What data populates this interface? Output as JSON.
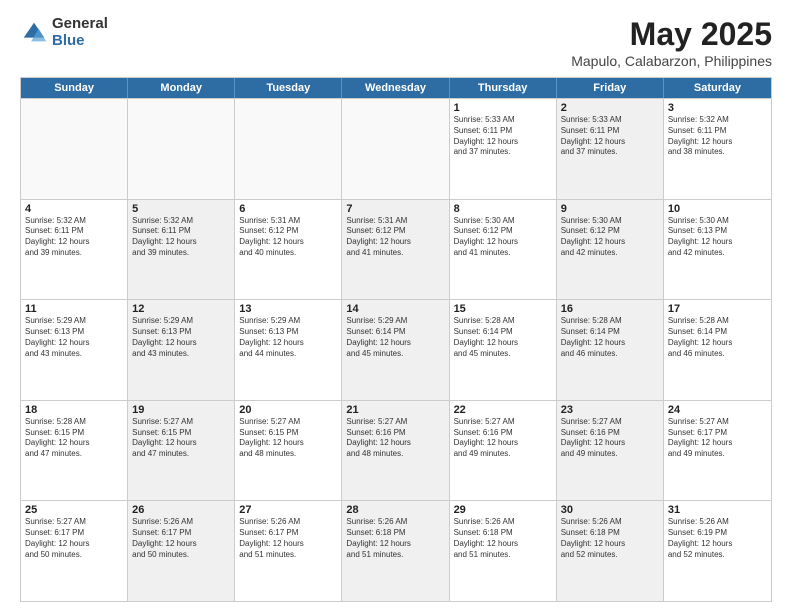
{
  "logo": {
    "general": "General",
    "blue": "Blue"
  },
  "title": "May 2025",
  "subtitle": "Mapulo, Calabarzon, Philippines",
  "days": [
    "Sunday",
    "Monday",
    "Tuesday",
    "Wednesday",
    "Thursday",
    "Friday",
    "Saturday"
  ],
  "weeks": [
    [
      {
        "day": "",
        "text": "",
        "shaded": true
      },
      {
        "day": "",
        "text": "",
        "shaded": true
      },
      {
        "day": "",
        "text": "",
        "shaded": true
      },
      {
        "day": "",
        "text": "",
        "shaded": true
      },
      {
        "day": "1",
        "text": "Sunrise: 5:33 AM\nSunset: 6:11 PM\nDaylight: 12 hours\nand 37 minutes.",
        "shaded": false
      },
      {
        "day": "2",
        "text": "Sunrise: 5:33 AM\nSunset: 6:11 PM\nDaylight: 12 hours\nand 37 minutes.",
        "shaded": true
      },
      {
        "day": "3",
        "text": "Sunrise: 5:32 AM\nSunset: 6:11 PM\nDaylight: 12 hours\nand 38 minutes.",
        "shaded": false
      }
    ],
    [
      {
        "day": "4",
        "text": "Sunrise: 5:32 AM\nSunset: 6:11 PM\nDaylight: 12 hours\nand 39 minutes.",
        "shaded": false
      },
      {
        "day": "5",
        "text": "Sunrise: 5:32 AM\nSunset: 6:11 PM\nDaylight: 12 hours\nand 39 minutes.",
        "shaded": true
      },
      {
        "day": "6",
        "text": "Sunrise: 5:31 AM\nSunset: 6:12 PM\nDaylight: 12 hours\nand 40 minutes.",
        "shaded": false
      },
      {
        "day": "7",
        "text": "Sunrise: 5:31 AM\nSunset: 6:12 PM\nDaylight: 12 hours\nand 41 minutes.",
        "shaded": true
      },
      {
        "day": "8",
        "text": "Sunrise: 5:30 AM\nSunset: 6:12 PM\nDaylight: 12 hours\nand 41 minutes.",
        "shaded": false
      },
      {
        "day": "9",
        "text": "Sunrise: 5:30 AM\nSunset: 6:12 PM\nDaylight: 12 hours\nand 42 minutes.",
        "shaded": true
      },
      {
        "day": "10",
        "text": "Sunrise: 5:30 AM\nSunset: 6:13 PM\nDaylight: 12 hours\nand 42 minutes.",
        "shaded": false
      }
    ],
    [
      {
        "day": "11",
        "text": "Sunrise: 5:29 AM\nSunset: 6:13 PM\nDaylight: 12 hours\nand 43 minutes.",
        "shaded": false
      },
      {
        "day": "12",
        "text": "Sunrise: 5:29 AM\nSunset: 6:13 PM\nDaylight: 12 hours\nand 43 minutes.",
        "shaded": true
      },
      {
        "day": "13",
        "text": "Sunrise: 5:29 AM\nSunset: 6:13 PM\nDaylight: 12 hours\nand 44 minutes.",
        "shaded": false
      },
      {
        "day": "14",
        "text": "Sunrise: 5:29 AM\nSunset: 6:14 PM\nDaylight: 12 hours\nand 45 minutes.",
        "shaded": true
      },
      {
        "day": "15",
        "text": "Sunrise: 5:28 AM\nSunset: 6:14 PM\nDaylight: 12 hours\nand 45 minutes.",
        "shaded": false
      },
      {
        "day": "16",
        "text": "Sunrise: 5:28 AM\nSunset: 6:14 PM\nDaylight: 12 hours\nand 46 minutes.",
        "shaded": true
      },
      {
        "day": "17",
        "text": "Sunrise: 5:28 AM\nSunset: 6:14 PM\nDaylight: 12 hours\nand 46 minutes.",
        "shaded": false
      }
    ],
    [
      {
        "day": "18",
        "text": "Sunrise: 5:28 AM\nSunset: 6:15 PM\nDaylight: 12 hours\nand 47 minutes.",
        "shaded": false
      },
      {
        "day": "19",
        "text": "Sunrise: 5:27 AM\nSunset: 6:15 PM\nDaylight: 12 hours\nand 47 minutes.",
        "shaded": true
      },
      {
        "day": "20",
        "text": "Sunrise: 5:27 AM\nSunset: 6:15 PM\nDaylight: 12 hours\nand 48 minutes.",
        "shaded": false
      },
      {
        "day": "21",
        "text": "Sunrise: 5:27 AM\nSunset: 6:16 PM\nDaylight: 12 hours\nand 48 minutes.",
        "shaded": true
      },
      {
        "day": "22",
        "text": "Sunrise: 5:27 AM\nSunset: 6:16 PM\nDaylight: 12 hours\nand 49 minutes.",
        "shaded": false
      },
      {
        "day": "23",
        "text": "Sunrise: 5:27 AM\nSunset: 6:16 PM\nDaylight: 12 hours\nand 49 minutes.",
        "shaded": true
      },
      {
        "day": "24",
        "text": "Sunrise: 5:27 AM\nSunset: 6:17 PM\nDaylight: 12 hours\nand 49 minutes.",
        "shaded": false
      }
    ],
    [
      {
        "day": "25",
        "text": "Sunrise: 5:27 AM\nSunset: 6:17 PM\nDaylight: 12 hours\nand 50 minutes.",
        "shaded": false
      },
      {
        "day": "26",
        "text": "Sunrise: 5:26 AM\nSunset: 6:17 PM\nDaylight: 12 hours\nand 50 minutes.",
        "shaded": true
      },
      {
        "day": "27",
        "text": "Sunrise: 5:26 AM\nSunset: 6:17 PM\nDaylight: 12 hours\nand 51 minutes.",
        "shaded": false
      },
      {
        "day": "28",
        "text": "Sunrise: 5:26 AM\nSunset: 6:18 PM\nDaylight: 12 hours\nand 51 minutes.",
        "shaded": true
      },
      {
        "day": "29",
        "text": "Sunrise: 5:26 AM\nSunset: 6:18 PM\nDaylight: 12 hours\nand 51 minutes.",
        "shaded": false
      },
      {
        "day": "30",
        "text": "Sunrise: 5:26 AM\nSunset: 6:18 PM\nDaylight: 12 hours\nand 52 minutes.",
        "shaded": true
      },
      {
        "day": "31",
        "text": "Sunrise: 5:26 AM\nSunset: 6:19 PM\nDaylight: 12 hours\nand 52 minutes.",
        "shaded": false
      }
    ]
  ]
}
